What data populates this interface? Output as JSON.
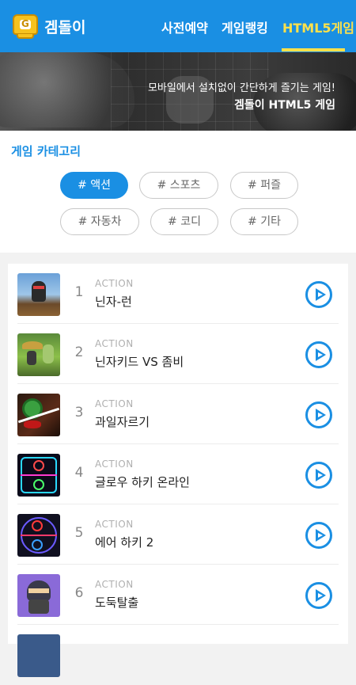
{
  "header": {
    "brand": "겜돌이",
    "nav": [
      {
        "label": "사전예약"
      },
      {
        "label": "게임랭킹"
      },
      {
        "label": "HTML5게임"
      }
    ]
  },
  "banner": {
    "line1": "모바일에서 설치없이 간단하게 즐기는 게임!",
    "line2": "겜돌이 HTML5 게임"
  },
  "category": {
    "title": "게임 카테고리",
    "chips": [
      {
        "label": "# 액션"
      },
      {
        "label": "# 스포츠"
      },
      {
        "label": "# 퍼즐"
      },
      {
        "label": "# 자동차"
      },
      {
        "label": "# 코디"
      },
      {
        "label": "# 기타"
      }
    ]
  },
  "games": [
    {
      "rank": "1",
      "genre": "ACTION",
      "name": "닌자-런"
    },
    {
      "rank": "2",
      "genre": "ACTION",
      "name": "닌자키드 VS 좀비"
    },
    {
      "rank": "3",
      "genre": "ACTION",
      "name": "과일자르기"
    },
    {
      "rank": "4",
      "genre": "ACTION",
      "name": "글로우 하키 온라인"
    },
    {
      "rank": "5",
      "genre": "ACTION",
      "name": "에어 하키 2"
    },
    {
      "rank": "6",
      "genre": "ACTION",
      "name": "도둑탈출"
    }
  ],
  "colors": {
    "accent": "#1a8fe3",
    "active_nav": "#ffe14a"
  }
}
